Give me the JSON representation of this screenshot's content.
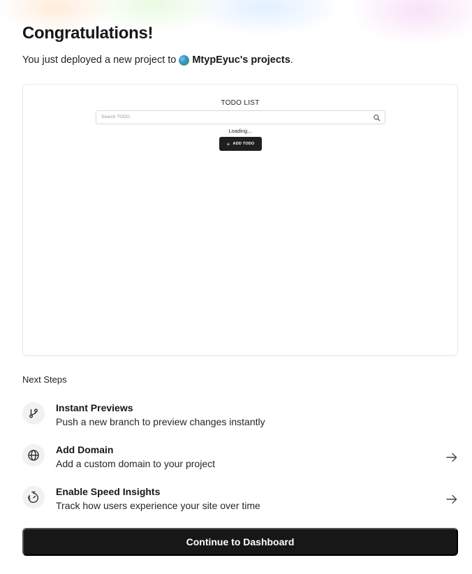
{
  "header": {
    "title": "Congratulations!",
    "subtitle_prefix": "You just deployed a new project to",
    "team_name": "MtypEyuc's projects",
    "subtitle_suffix": "."
  },
  "preview": {
    "app_title": "TODO LIST",
    "search_placeholder": "Search TODO",
    "loading_text": "Loading...",
    "add_button_label": "ADD TODO"
  },
  "next_steps": {
    "label": "Next Steps",
    "items": [
      {
        "title": "Instant Previews",
        "description": "Push a new branch to preview changes instantly",
        "icon": "git-branch-icon",
        "has_arrow": false
      },
      {
        "title": "Add Domain",
        "description": "Add a custom domain to your project",
        "icon": "globe-icon",
        "has_arrow": true
      },
      {
        "title": "Enable Speed Insights",
        "description": "Track how users experience your site over time",
        "icon": "stopwatch-icon",
        "has_arrow": true
      }
    ]
  },
  "cta": {
    "label": "Continue to Dashboard"
  },
  "colors": {
    "primary": "#171717",
    "icon_bg": "#f1f1f1",
    "border": "#e6e6e6"
  }
}
